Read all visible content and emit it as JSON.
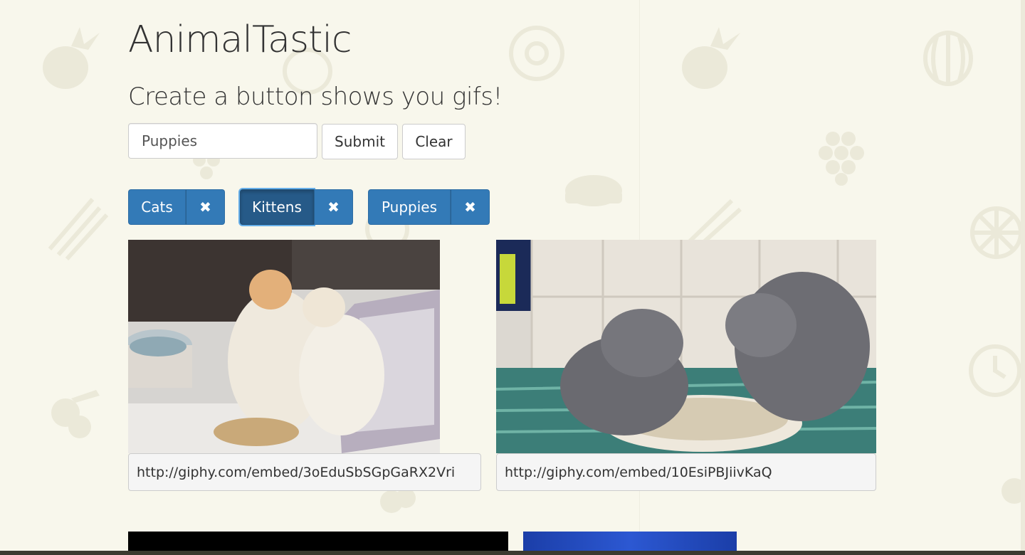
{
  "header": {
    "title": "AnimalTastic",
    "subtitle": "Create a button shows you gifs!"
  },
  "form": {
    "input_value": "Puppies",
    "submit_label": "Submit",
    "clear_label": "Clear"
  },
  "tags": [
    {
      "label": "Cats",
      "close_icon": "✖",
      "active": false
    },
    {
      "label": "Kittens",
      "close_icon": "✖",
      "active": true
    },
    {
      "label": "Puppies",
      "close_icon": "✖",
      "active": false
    }
  ],
  "gifs": [
    {
      "url": "http://giphy.com/embed/3oEduSbSGpGaRX2Vri"
    },
    {
      "url": "http://giphy.com/embed/10EsiPBJiivKaQ"
    }
  ],
  "colors": {
    "background": "#f8f7ec",
    "primary": "#337ab7",
    "primary_active": "#265a88"
  },
  "icons": [
    "pineapple-icon",
    "donut-icon",
    "watermelon-icon",
    "grapes-icon",
    "steak-icon",
    "asparagus-icon",
    "cherries-icon",
    "citrus-icon",
    "clock-icon",
    "broccoli-icon"
  ]
}
